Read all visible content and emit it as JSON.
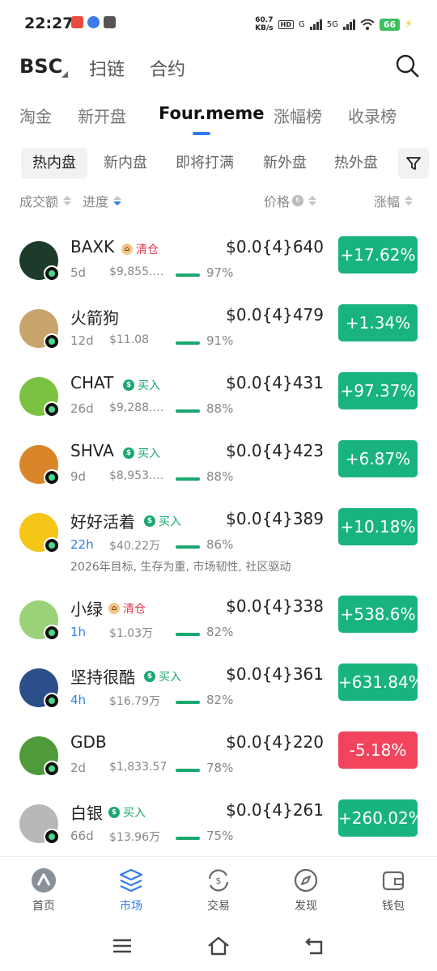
{
  "status": {
    "time": "22:27",
    "speed_value": "60.7",
    "speed_unit": "KB/s",
    "signal1": "G",
    "signal2": "5G",
    "battery": "66",
    "hd": "HD"
  },
  "header": {
    "chain": "BSC",
    "nav": [
      "扫链",
      "合约"
    ]
  },
  "tabs": [
    "淘金",
    "新开盘",
    "Four.meme",
    "涨幅榜",
    "收录榜"
  ],
  "active_tab": "Four.meme",
  "chips": [
    "热内盘",
    "新内盘",
    "即将打满",
    "新外盘",
    "热外盘"
  ],
  "active_chip": "热内盘",
  "sort_header": {
    "volume": "成交额",
    "progress": "进度",
    "price": "价格",
    "price_count": "6",
    "change": "涨幅"
  },
  "tokens": [
    {
      "name": "BAXK",
      "tag": "清仓",
      "tag_type": "sell",
      "age": "5d",
      "volume": "$9,855.…",
      "progress": 97,
      "progress_label": "97%",
      "price": "$0.0{4}640",
      "change": "+17.62%",
      "direction": "up",
      "avatar_color": "#1d3b2a"
    },
    {
      "name": "火箭狗",
      "tag": "",
      "tag_type": "",
      "age": "12d",
      "volume": "$11.08",
      "progress": 91,
      "progress_label": "91%",
      "price": "$0.0{4}479",
      "change": "+1.34%",
      "direction": "up",
      "avatar_color": "#c8a46c"
    },
    {
      "name": "CHAT",
      "tag": "买入",
      "tag_type": "buy",
      "age": "26d",
      "volume": "$9,288.…",
      "progress": 88,
      "progress_label": "88%",
      "price": "$0.0{4}431",
      "change": "+97.37%",
      "direction": "up",
      "avatar_color": "#7cc242"
    },
    {
      "name": "SHVA",
      "tag": "买入",
      "tag_type": "buy",
      "age": "9d",
      "volume": "$8,953.…",
      "progress": 88,
      "progress_label": "88%",
      "price": "$0.0{4}423",
      "change": "+6.87%",
      "direction": "up",
      "avatar_color": "#d9862b"
    },
    {
      "name": "好好活着",
      "tag": "买入",
      "tag_type": "buy",
      "age": "22h",
      "age_blue": true,
      "volume": "$40.22万",
      "progress": 86,
      "progress_label": "86%",
      "price": "$0.0{4}389",
      "change": "+10.18%",
      "direction": "up",
      "avatar_color": "#f5c518",
      "note": "2026年目标, 生存为重, 市场韧性, 社区驱动"
    },
    {
      "name": "小绿",
      "tag": "清仓",
      "tag_type": "sell",
      "age": "1h",
      "age_blue": true,
      "volume": "$1.03万",
      "progress": 82,
      "progress_label": "82%",
      "price": "$0.0{4}338",
      "change": "+538.6%",
      "direction": "up",
      "avatar_color": "#9bd27a"
    },
    {
      "name": "坚持很酷",
      "tag": "买入",
      "tag_type": "buy",
      "age": "4h",
      "age_blue": true,
      "volume": "$16.79万",
      "progress": 82,
      "progress_label": "82%",
      "price": "$0.0{4}361",
      "change": "+631.84%",
      "direction": "up",
      "avatar_color": "#2a4f8a"
    },
    {
      "name": "GDB",
      "tag": "",
      "tag_type": "",
      "age": "2d",
      "volume": "$1,833.57",
      "progress": 78,
      "progress_label": "78%",
      "price": "$0.0{4}220",
      "change": "-5.18%",
      "direction": "down",
      "avatar_color": "#4f9a3a"
    },
    {
      "name": "白银",
      "tag": "买入",
      "tag_type": "buy",
      "age": "66d",
      "volume": "$13.96万",
      "progress": 75,
      "progress_label": "75%",
      "price": "$0.0{4}261",
      "change": "+260.02%",
      "direction": "up",
      "avatar_color": "#b8b8b8"
    }
  ],
  "bottom_nav": [
    {
      "label": "首页",
      "icon": "home-icon"
    },
    {
      "label": "市场",
      "icon": "market-icon"
    },
    {
      "label": "交易",
      "icon": "trade-icon"
    },
    {
      "label": "发现",
      "icon": "discover-icon"
    },
    {
      "label": "钱包",
      "icon": "wallet-icon"
    }
  ],
  "active_nav": "市场",
  "colors": {
    "accent": "#2f7dea",
    "up": "#19b47d",
    "down": "#f2445d",
    "buy": "#19a96f",
    "sell": "#e0384f"
  }
}
